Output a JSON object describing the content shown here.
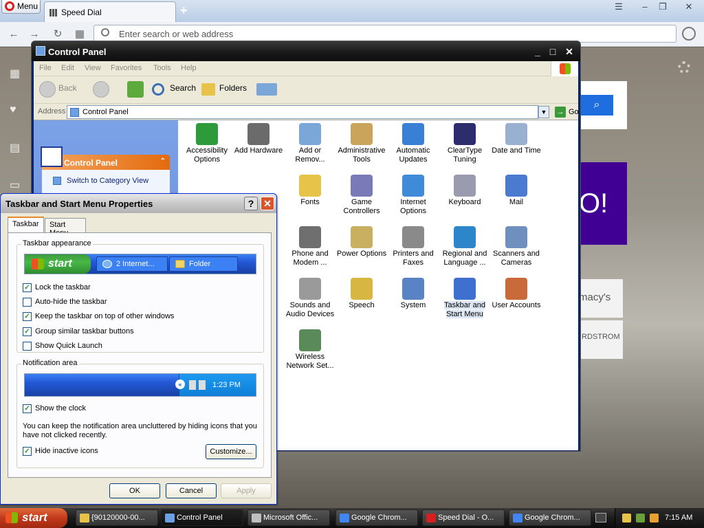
{
  "browser": {
    "menu_label": "Menu",
    "tab_title": "Speed Dial",
    "search_placeholder": "Enter search or web address"
  },
  "speed_dial": {
    "yahoo_text": "O!",
    "tile1": "macy's",
    "tile2": "RDSTROM"
  },
  "control_panel": {
    "title": "Control Panel",
    "menu": [
      "File",
      "Edit",
      "View",
      "Favorites",
      "Tools",
      "Help"
    ],
    "toolbar": {
      "back": "Back",
      "search": "Search",
      "folders": "Folders"
    },
    "address_label": "Address",
    "address_value": "Control Panel",
    "go_label": "Go",
    "task_header": "Control Panel",
    "task_link": "Switch to Category View",
    "icons": [
      {
        "name": "Accessibility Options",
        "color": "#2e9b3a"
      },
      {
        "name": "Add Hardware",
        "color": "#6b6b6b"
      },
      {
        "name": "Add or Remov...",
        "color": "#7aa7d8"
      },
      {
        "name": "Administrative Tools",
        "color": "#c9a45a"
      },
      {
        "name": "Automatic Updates",
        "color": "#3a7fd6"
      },
      {
        "name": "ClearType Tuning",
        "color": "#2d2d6e"
      },
      {
        "name": "Date and Time",
        "color": "#9ab0d0"
      },
      {
        "name": "Fonts",
        "color": "#e8c34a"
      },
      {
        "name": "Game Controllers",
        "color": "#7a7ab8"
      },
      {
        "name": "Internet Options",
        "color": "#3f8bd9"
      },
      {
        "name": "Keyboard",
        "color": "#9b9bb0"
      },
      {
        "name": "Mail",
        "color": "#4b7bd0"
      },
      {
        "name": "Phone and Modem ...",
        "color": "#6f6f6f"
      },
      {
        "name": "Power Options",
        "color": "#c8b060"
      },
      {
        "name": "Printers and Faxes",
        "color": "#8a8a8a"
      },
      {
        "name": "Regional and Language ...",
        "color": "#2d86c9"
      },
      {
        "name": "Scanners and Cameras",
        "color": "#6f8fbf"
      },
      {
        "name": "Sounds and Audio Devices",
        "color": "#9a9a9a"
      },
      {
        "name": "Speech",
        "color": "#d8b642"
      },
      {
        "name": "System",
        "color": "#5a83c6"
      },
      {
        "name": "Taskbar and Start Menu",
        "color": "#3f6fcf"
      },
      {
        "name": "User Accounts",
        "color": "#c96a3a"
      },
      {
        "name": "Wireless Network Set...",
        "color": "#5a8a5a"
      }
    ]
  },
  "dialog": {
    "title": "Taskbar and Start Menu Properties",
    "help": "?",
    "tabs": [
      "Taskbar",
      "Start Menu"
    ],
    "appearance_label": "Taskbar appearance",
    "preview_start": "start",
    "preview_btn1": "2 Internet...",
    "preview_btn2": "Folder",
    "options": [
      {
        "label": "Lock the taskbar",
        "checked": true
      },
      {
        "label": "Auto-hide the taskbar",
        "checked": false
      },
      {
        "label": "Keep the taskbar on top of other windows",
        "checked": true
      },
      {
        "label": "Group similar taskbar buttons",
        "checked": true
      },
      {
        "label": "Show Quick Launch",
        "checked": false
      }
    ],
    "notification_label": "Notification area",
    "preview_time": "1:23 PM",
    "show_clock": "Show the clock",
    "note": "You can keep the notification area uncluttered by hiding icons that you have not clicked recently.",
    "hide_inactive": "Hide inactive icons",
    "customize": "Customize...",
    "ok": "OK",
    "cancel": "Cancel",
    "apply": "Apply"
  },
  "taskbar": {
    "start": "start",
    "tasks": [
      {
        "label": "{90120000-00...",
        "color": "#e8c34a"
      },
      {
        "label": "Control Panel",
        "color": "#6ba1e2"
      },
      {
        "label": "Microsoft Offic...",
        "color": "#c0c0c0"
      },
      {
        "label": "Google Chrom...",
        "color": "#4285f4"
      },
      {
        "label": "Speed Dial - O...",
        "color": "#d4201f"
      },
      {
        "label": "Google Chrom...",
        "color": "#4285f4"
      }
    ],
    "clock": "7:15 AM"
  }
}
